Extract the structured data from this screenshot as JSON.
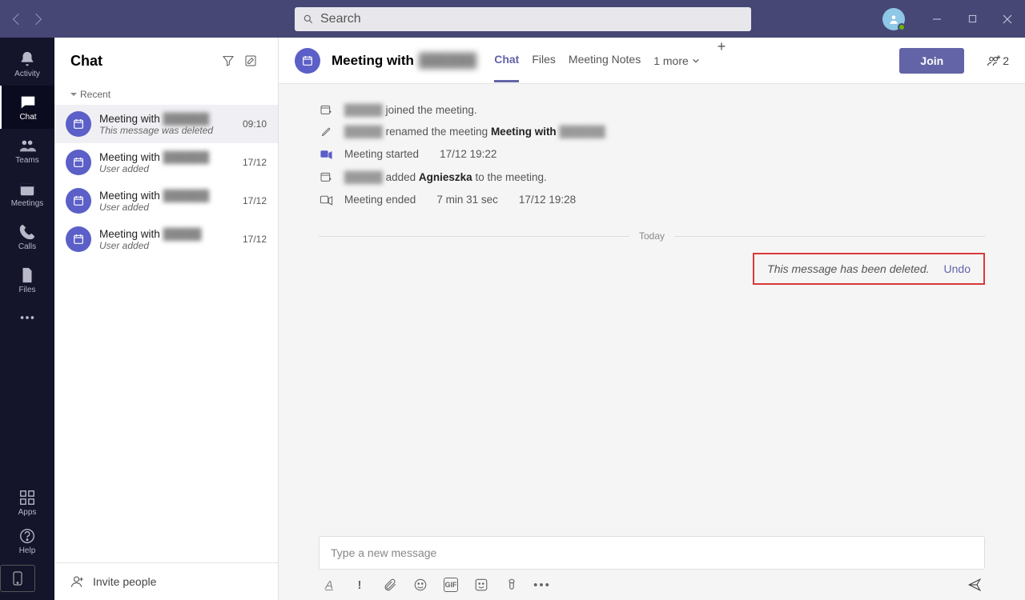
{
  "titlebar": {
    "search_placeholder": "Search"
  },
  "rail": {
    "items": [
      {
        "label": "Activity"
      },
      {
        "label": "Chat"
      },
      {
        "label": "Teams"
      },
      {
        "label": "Meetings"
      },
      {
        "label": "Calls"
      },
      {
        "label": "Files"
      }
    ],
    "apps_label": "Apps",
    "help_label": "Help"
  },
  "chatlist": {
    "title": "Chat",
    "section": "Recent",
    "items": [
      {
        "title_prefix": "Meeting with",
        "blurred": "██████",
        "preview": "This message was deleted",
        "time": "09:10"
      },
      {
        "title_prefix": "Meeting with",
        "blurred": "██████",
        "preview": "User added",
        "time": "17/12"
      },
      {
        "title_prefix": "Meeting with",
        "blurred": "██████",
        "preview": "User added",
        "time": "17/12"
      },
      {
        "title_prefix": "Meeting with",
        "blurred": "█████",
        "preview": "User added",
        "time": "17/12"
      }
    ],
    "invite": "Invite people"
  },
  "main": {
    "title_prefix": "Meeting with",
    "title_blurred": "██████",
    "tabs": {
      "chat": "Chat",
      "files": "Files",
      "notes": "Meeting Notes",
      "more": "1 more"
    },
    "join": "Join",
    "participant_count": "2",
    "feed": {
      "joined_suffix": "joined the meeting.",
      "renamed_mid": "renamed the meeting",
      "renamed_title_prefix": "Meeting with",
      "started": "Meeting started",
      "started_ts": "17/12 19:22",
      "added_mid": "added",
      "added_name": "Agnieszka",
      "added_suffix": "to the meeting.",
      "ended": "Meeting ended",
      "ended_dur": "7 min 31 sec",
      "ended_ts": "17/12 19:28",
      "today": "Today",
      "deleted_msg": "This message has been deleted.",
      "undo": "Undo"
    },
    "composer_placeholder": "Type a new message"
  }
}
